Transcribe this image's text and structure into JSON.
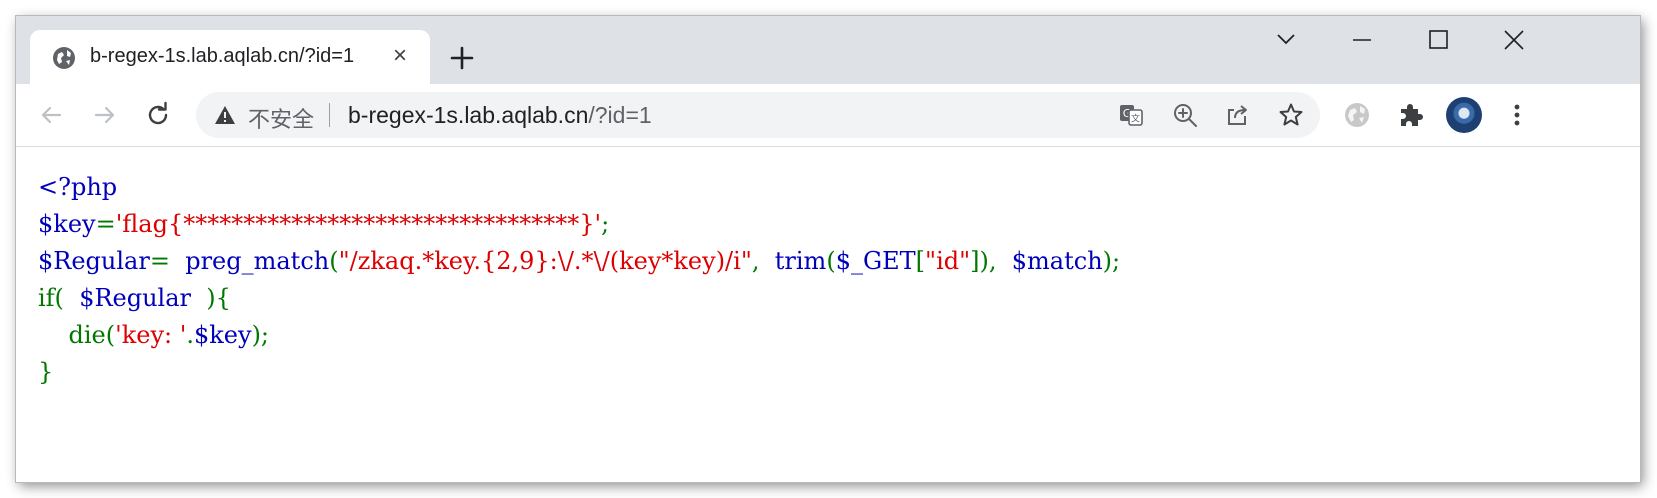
{
  "browser": {
    "tab": {
      "title": "b-regex-1s.lab.aqlab.cn/?id=1",
      "close_symbol": "×",
      "favicon": "globe-icon"
    },
    "new_tab_icon": "plus-icon",
    "window_controls": [
      "chevron-down-icon",
      "minimize-icon",
      "maximize-icon",
      "close-icon"
    ],
    "nav": {
      "back_icon": "arrow-left-icon",
      "forward_icon": "arrow-right-icon",
      "reload_icon": "reload-icon"
    },
    "omnibox": {
      "security_label": "不安全",
      "url_host": "b-regex-1s.lab.aqlab.cn",
      "url_path": "/?id=1",
      "icons": [
        "translate-icon",
        "zoom-in-icon",
        "share-icon",
        "star-icon"
      ]
    },
    "toolbar_icons": [
      "extension-globe-icon",
      "puzzle-icon",
      "avatar",
      "kebab-menu-icon"
    ]
  },
  "page": {
    "code_lines": [
      [
        {
          "t": "<?php",
          "c": "default"
        }
      ],
      [
        {
          "t": "$key",
          "c": "default"
        },
        {
          "t": "=",
          "c": "keyword"
        },
        {
          "t": "'flag{*********************************}'",
          "c": "string"
        },
        {
          "t": ";",
          "c": "keyword"
        }
      ],
      [
        {
          "t": "$Regular",
          "c": "default"
        },
        {
          "t": "= ",
          "c": "keyword"
        },
        {
          "t": " preg_match",
          "c": "default"
        },
        {
          "t": "(",
          "c": "keyword"
        },
        {
          "t": "\"/zkaq.*key.{2,9}:\\/.*\\/(key*key)/i\"",
          "c": "string"
        },
        {
          "t": ", ",
          "c": "keyword"
        },
        {
          "t": " trim",
          "c": "default"
        },
        {
          "t": "(",
          "c": "keyword"
        },
        {
          "t": "$_GET",
          "c": "default"
        },
        {
          "t": "[",
          "c": "keyword"
        },
        {
          "t": "\"id\"",
          "c": "string"
        },
        {
          "t": "]), ",
          "c": "keyword"
        },
        {
          "t": " $match",
          "c": "default"
        },
        {
          "t": ");",
          "c": "keyword"
        }
      ],
      [
        {
          "t": "if( ",
          "c": "keyword"
        },
        {
          "t": " $Regular ",
          "c": "default"
        },
        {
          "t": " ){",
          "c": "keyword"
        }
      ],
      [
        {
          "t": "    die(",
          "c": "keyword"
        },
        {
          "t": "'key: '",
          "c": "string"
        },
        {
          "t": ".",
          "c": "keyword"
        },
        {
          "t": "$key",
          "c": "default"
        },
        {
          "t": ");",
          "c": "keyword"
        }
      ],
      [
        {
          "t": "}",
          "c": "keyword"
        }
      ]
    ],
    "colors": {
      "default": "#0000bb",
      "keyword": "#007700",
      "string": "#dd0000"
    }
  }
}
